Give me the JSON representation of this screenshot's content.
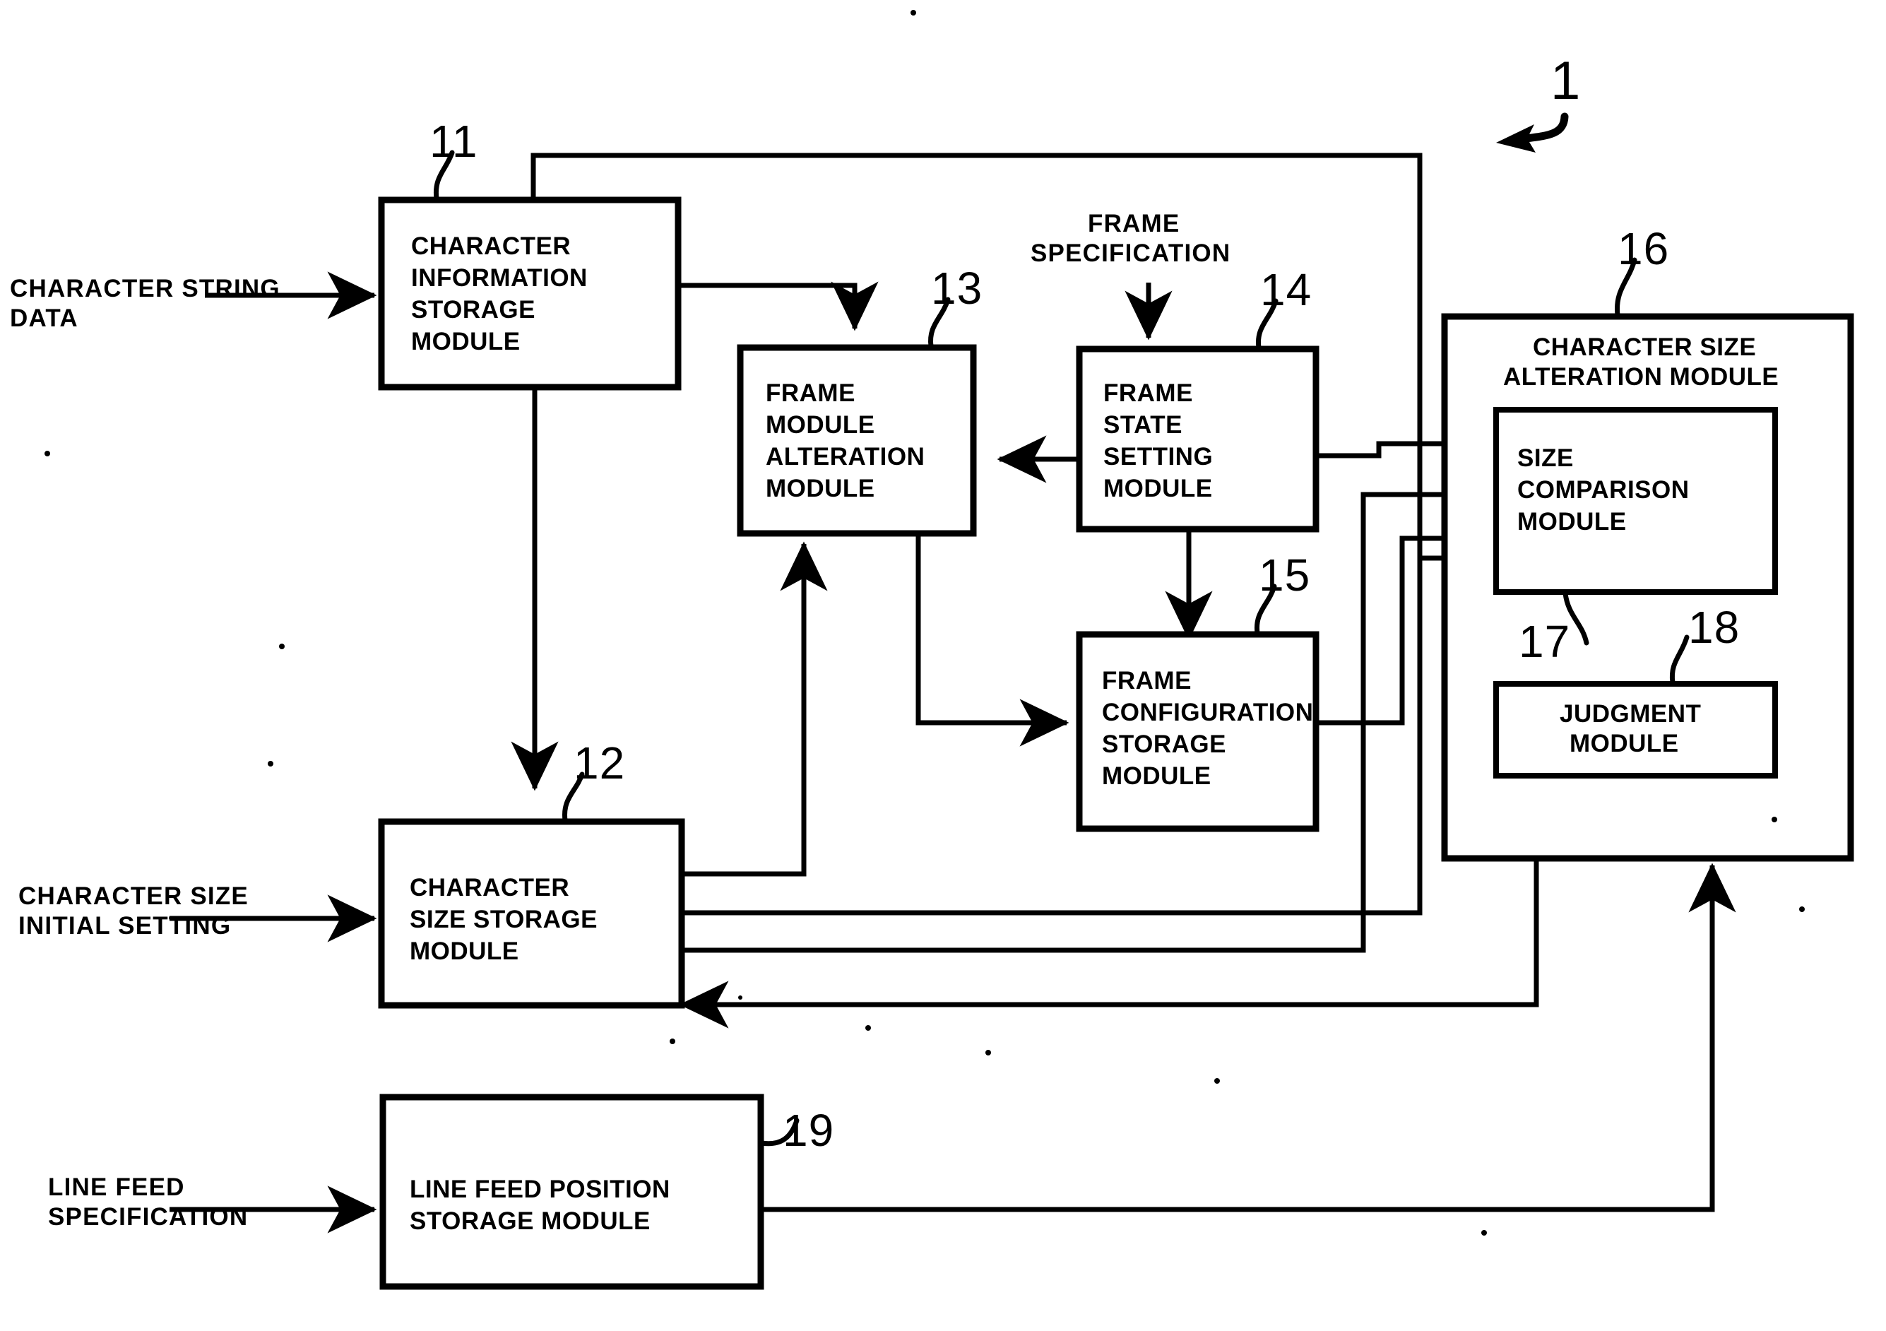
{
  "figure": {
    "system_ref": "1",
    "external_inputs": [
      {
        "id": "character-string-data",
        "lines": [
          "CHARACTER  STRING",
          "DATA"
        ]
      },
      {
        "id": "character-size-initial-setting",
        "lines": [
          "CHARACTER  SIZE",
          "INITIAL  SETTING"
        ]
      },
      {
        "id": "line-feed-specification",
        "lines": [
          "LINE  FEED",
          "SPECIFICATION"
        ]
      },
      {
        "id": "frame-specification",
        "lines": [
          "FRAME",
          "SPECIFICATION"
        ]
      }
    ],
    "blocks": [
      {
        "id": "character-information-storage-module",
        "ref": "11",
        "lines": [
          "CHARACTER",
          "INFORMATION",
          "STORAGE",
          "MODULE"
        ]
      },
      {
        "id": "character-size-storage-module",
        "ref": "12",
        "lines": [
          "CHARACTER",
          "SIZE STORAGE",
          "MODULE"
        ]
      },
      {
        "id": "frame-module-alteration-module",
        "ref": "13",
        "lines": [
          "FRAME",
          "MODULE",
          "ALTERATION",
          "MODULE"
        ]
      },
      {
        "id": "frame-state-setting-module",
        "ref": "14",
        "lines": [
          "FRAME",
          "STATE",
          "SETTING",
          "MODULE"
        ]
      },
      {
        "id": "frame-configuration-storage-module",
        "ref": "15",
        "lines": [
          "FRAME",
          "CONFIGURATION",
          "STORAGE",
          "MODULE"
        ]
      },
      {
        "id": "character-size-alteration-module",
        "ref": "16",
        "lines": [
          "CHARACTER  SIZE",
          "ALTERATION  MODULE"
        ]
      },
      {
        "id": "size-comparison-module",
        "ref": "17",
        "lines": [
          "SIZE",
          "COMPARISON",
          "MODULE"
        ]
      },
      {
        "id": "judgment-module",
        "ref": "18",
        "lines": [
          "JUDGMENT",
          "MODULE"
        ]
      },
      {
        "id": "line-feed-position-storage-module",
        "ref": "19",
        "lines": [
          "LINE FEED POSITION",
          "STORAGE MODULE"
        ]
      }
    ],
    "colors": {
      "ink": "#000000",
      "paper": "#ffffff"
    }
  }
}
